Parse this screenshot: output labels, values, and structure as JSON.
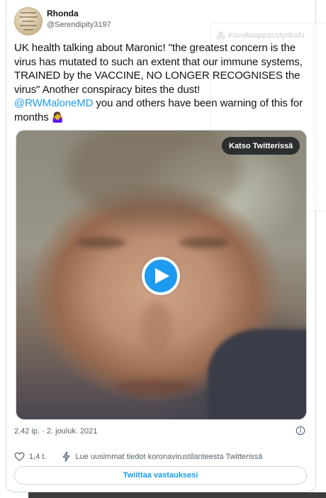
{
  "colors": {
    "accent": "#1d9bf0",
    "text": "#0f1419",
    "muted": "#536471",
    "border": "#cfd9de"
  },
  "author": {
    "display_name": "Rhonda",
    "handle": "@Serendipity3197"
  },
  "tweet": {
    "text_before": "UK health talking about Maronic! \"the greatest concern is the virus has mutated to such an extent that our immune systems, TRAINED by the VACCINE, NO LONGER RECOGNISES the virus\" Another conspiracy bites the dust!\n",
    "mention": "@RWMaloneMD",
    "text_after": " you and others have been warning of this for months ",
    "emoji": "🤷‍♀️"
  },
  "media": {
    "watch_label": "Katso Twitterissä",
    "play_icon": "play-icon"
  },
  "meta": {
    "timestamp": "2.42 ip. · 2. jouluk. 2021",
    "info_icon": "info-icon"
  },
  "actions": {
    "like_count": "1,4 t.",
    "news_link": "Lue uusimmat tiedot koronavirustilanteesta Twitterissä",
    "reply_label": "Twiittaa vastauksesi"
  },
  "ghost_overlay": {
    "tool_label": "Kuvakaappaustyökalu"
  }
}
